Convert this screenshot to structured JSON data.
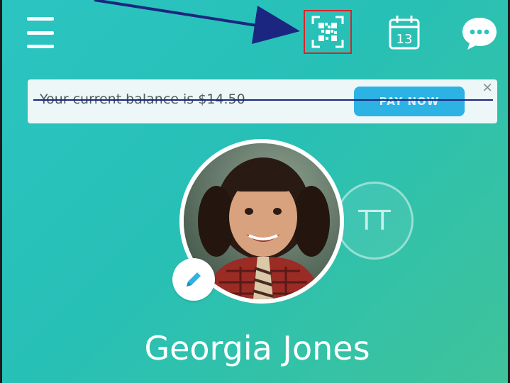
{
  "header": {
    "menu_icon": "hamburger-menu-icon",
    "qr_icon": "qr-code-scan-icon",
    "calendar_icon": "calendar-icon",
    "calendar_day": "13",
    "chat_icon": "chat-bubble-icon"
  },
  "balance": {
    "text": "Your current balance is $14.50",
    "pay_label": "PAY NOW",
    "close_label": "×"
  },
  "profile": {
    "name": "Georgia Jones",
    "secondary_initials": "TT",
    "edit_icon": "pencil-icon"
  },
  "colors": {
    "background_start": "#2cc4c1",
    "background_end": "#3fc39a",
    "pay_button": "#2cb3e4",
    "highlight_box": "#d9232a",
    "annotation_arrow": "#1b2680"
  }
}
